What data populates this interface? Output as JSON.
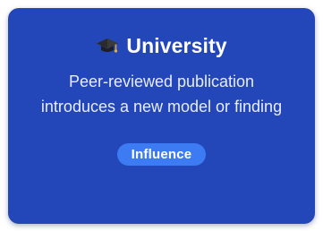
{
  "card": {
    "icon": "graduation-cap-icon",
    "title": "University",
    "description": "Peer-reviewed publication introduces a new model or finding",
    "badge": "Influence",
    "colors": {
      "card_background": "#2347b9",
      "badge_background": "#3d7bf2",
      "text": "#ffffff"
    }
  }
}
